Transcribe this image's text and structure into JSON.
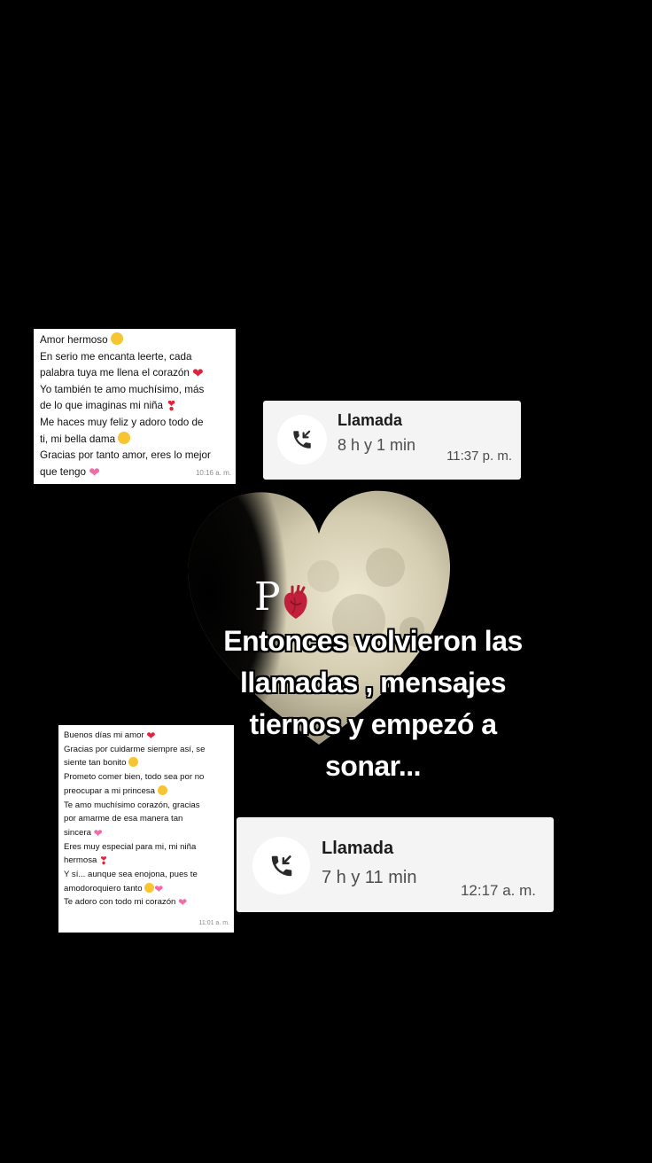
{
  "overlay": {
    "monogram": "P",
    "caption_lines": [
      "Entonces volvieron las",
      "llamadas , mensajes",
      "tiernos y empezó a",
      "sonar..."
    ]
  },
  "chat_1": {
    "lines": [
      "Amor hermoso",
      "En serio me encanta leerte, cada",
      "palabra tuya me llena el corazón",
      "Yo también te amo muchísimo, más",
      "de lo que imaginas mi niña",
      "Me haces muy feliz y adoro todo de",
      "ti, mi bella dama",
      "Gracias por tanto amor, eres lo mejor",
      "que tengo"
    ],
    "time": "10:16 a. m."
  },
  "chat_2": {
    "lines": [
      "Buenos días mi amor",
      "Gracias por cuidarme siempre así, se",
      "siente tan bonito",
      "Prometo comer bien, todo sea por no",
      "preocupar a mi princesa",
      "Te amo muchísimo corazón, gracias",
      "por amarme de esa manera tan",
      "sincera",
      "Eres muy especial para mi, mi niña",
      "hermosa",
      "Y sí... aunque sea enojona, pues te",
      "amodoroquiero tanto",
      "Te adoro con todo mi corazón"
    ],
    "time": "11:01 a. m."
  },
  "call_1": {
    "title": "Llamada",
    "duration": "8 h y 1 min",
    "time": "11:37 p. m."
  },
  "call_2": {
    "title": "Llamada",
    "duration": "7 h y 11 min",
    "time": "12:17 a. m."
  },
  "icons": {
    "call": "incoming-call-icon",
    "emojis": [
      "smiling-face-with-hearts",
      "red-heart",
      "heart-exclamation",
      "heart-eyes-face",
      "sparkling-heart",
      "pleading-face",
      "relieved-face",
      "two-hearts",
      "pink-heart"
    ]
  },
  "colors": {
    "background": "#000000",
    "bubble": "#ffffff",
    "call_card": "#f4f4f5",
    "heart_red": "#e0223b",
    "heart_pink": "#f06ba8"
  }
}
